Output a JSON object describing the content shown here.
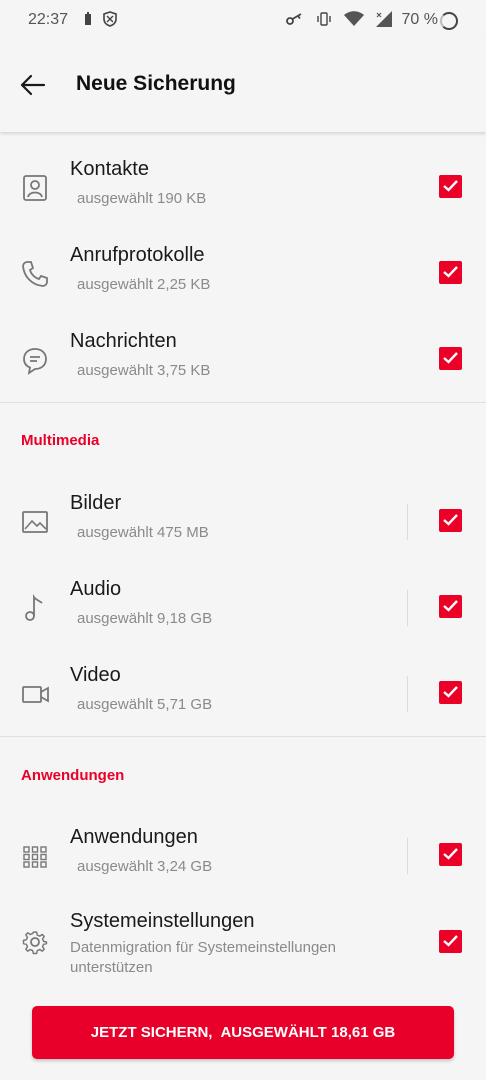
{
  "status_bar": {
    "time": "22:37",
    "battery_percent": "70 %"
  },
  "header": {
    "title": "Neue Sicherung"
  },
  "items_general": [
    {
      "label": "Kontakte",
      "sub": "ausgewählt 190 KB",
      "icon": "contact-icon",
      "checked": true
    },
    {
      "label": "Anrufprotokolle",
      "sub": "ausgewählt 2,25 KB",
      "icon": "phone-icon",
      "checked": true
    },
    {
      "label": "Nachrichten",
      "sub": "ausgewählt 3,75 KB",
      "icon": "message-icon",
      "checked": true
    }
  ],
  "section_multimedia": "Multimedia",
  "items_multimedia": [
    {
      "label": "Bilder",
      "sub": "ausgewählt 475 MB",
      "icon": "image-icon",
      "checked": true
    },
    {
      "label": "Audio",
      "sub": "ausgewählt 9,18 GB",
      "icon": "music-note-icon",
      "checked": true
    },
    {
      "label": "Video",
      "sub": "ausgewählt 5,71 GB",
      "icon": "video-camera-icon",
      "checked": true
    }
  ],
  "section_apps": "Anwendungen",
  "items_apps": [
    {
      "label": "Anwendungen",
      "sub": "ausgewählt 3,24 GB",
      "icon": "apps-grid-icon",
      "checked": true
    },
    {
      "label": "Systemeinstellungen",
      "sub": "Datenmigration für Systemeinstellungen unterstützen",
      "icon": "gear-icon",
      "checked": true
    }
  ],
  "cta": {
    "label": "JETZT SICHERN,",
    "size": "AUSGEWÄHLT 18,61 GB"
  },
  "colors": {
    "accent": "#eb0028"
  }
}
